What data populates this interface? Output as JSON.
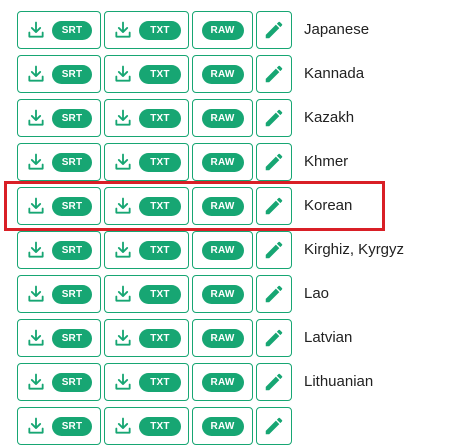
{
  "buttons": {
    "srt": "SRT",
    "txt": "TXT",
    "raw": "RAW"
  },
  "icons": {
    "download": "download-icon",
    "edit": "pencil-icon"
  },
  "colors": {
    "accent": "#17a673",
    "highlight": "#d91f26"
  },
  "rows": [
    {
      "language": "Japanese"
    },
    {
      "language": "Kannada"
    },
    {
      "language": "Kazakh"
    },
    {
      "language": "Khmer"
    },
    {
      "language": "Korean",
      "highlighted": true
    },
    {
      "language": "Kirghiz, Kyrgyz"
    },
    {
      "language": "Lao"
    },
    {
      "language": "Latvian"
    },
    {
      "language": "Lithuanian"
    },
    {
      "language": ""
    }
  ]
}
